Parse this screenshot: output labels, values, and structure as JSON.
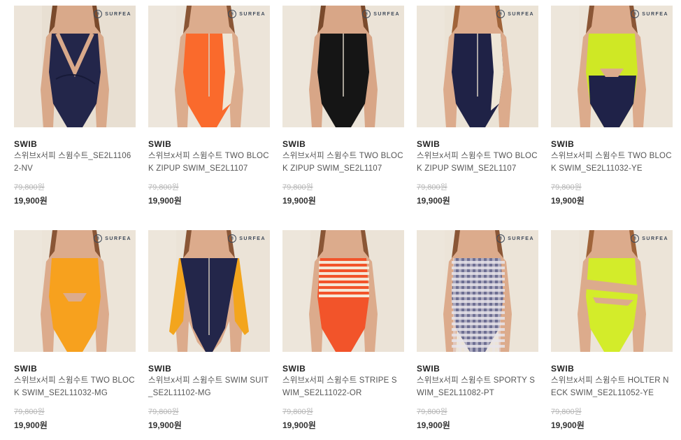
{
  "products": [
    {
      "brand": "SWIB",
      "name": "스위브x서피 스윔수트_SE2L11062-NV",
      "original_price": "79,800원",
      "sale_price": "19,900원",
      "logo_text": "SURFEA",
      "colors": {
        "bg": "#e8dfd2",
        "skin": "#d9a98a",
        "suit": "#23264a",
        "accent": "#23264a",
        "hair": "#7a4a2c"
      }
    },
    {
      "brand": "SWIB",
      "name": "스위브x서피 스윔수트 TWO BLOCK ZIPUP SWIM_SE2L1107",
      "original_price": "79,800원",
      "sale_price": "19,900원",
      "logo_text": "SURFEA",
      "colors": {
        "bg": "#ece4d9",
        "skin": "#dcac8d",
        "suit": "#fa6a2c",
        "accent": "#efe6d6",
        "hair": "#8a5636"
      }
    },
    {
      "brand": "SWIB",
      "name": "스위브x서피 스윔수트 TWO BLOCK ZIPUP SWIM_SE2L1107",
      "original_price": "79,800원",
      "sale_price": "19,900원",
      "logo_text": "SURFEA",
      "colors": {
        "bg": "#ebe3d7",
        "skin": "#d8a687",
        "suit": "#151515",
        "accent": "#151515",
        "hair": "#7a4a2c"
      }
    },
    {
      "brand": "SWIB",
      "name": "스위브x서피 스윔수트 TWO BLOCK ZIPUP SWIM_SE2L1107",
      "original_price": "79,800원",
      "sale_price": "19,900원",
      "logo_text": "SURFEA",
      "colors": {
        "bg": "#ebe3d6",
        "skin": "#dcab8c",
        "suit": "#1f2246",
        "accent": "#eee6d6",
        "hair": "#a0643a"
      }
    },
    {
      "brand": "SWIB",
      "name": "스위브x서피 스윔수트 TWO BLOCK SWIM_SE2L11032-YE",
      "original_price": "79,800원",
      "sale_price": "19,900원",
      "logo_text": "SURFEA",
      "colors": {
        "bg": "#ece4d8",
        "skin": "#dcab8c",
        "suit": "#cfe825",
        "accent": "#1f2248",
        "hair": "#8a5636"
      }
    },
    {
      "brand": "SWIB",
      "name": "스위브x서피 스윔수트 TWO BLOCK SWIM_SE2L11032-MG",
      "original_price": "79,800원",
      "sale_price": "19,900원",
      "logo_text": "SURFEA",
      "colors": {
        "bg": "#ece4d8",
        "skin": "#dcab8c",
        "suit": "#f7a11e",
        "accent": "#f7a11e",
        "hair": "#8a5636"
      }
    },
    {
      "brand": "SWIB",
      "name": "스위브x서피 스윔수트 SWIM SUIT_SE2L11102-MG",
      "original_price": "79,800원",
      "sale_price": "19,900원",
      "logo_text": "SURFEA",
      "colors": {
        "bg": "#ebe3d7",
        "skin": "#dcab8c",
        "suit": "#23264a",
        "accent": "#f3a51d",
        "hair": "#8a5636"
      }
    },
    {
      "brand": "SWIB",
      "name": "스위브x서피 스윔수트 STRIPE SWIM_SE2L11022-OR",
      "original_price": "79,800원",
      "sale_price": "19,900원",
      "logo_text": "",
      "colors": {
        "bg": "#ebe3d7",
        "skin": "#dcab8c",
        "suit": "#f2542a",
        "accent": "#f5e7d6",
        "hair": "#8a5636"
      }
    },
    {
      "brand": "SWIB",
      "name": "스위브x서피 스윔수트 SPORTY SWIM_SE2L11082-PT",
      "original_price": "79,800원",
      "sale_price": "19,900원",
      "logo_text": "SURFEA",
      "colors": {
        "bg": "#ece4d8",
        "skin": "#dcab8c",
        "suit": "#6e6f93",
        "accent": "#e8e4ea",
        "hair": "#8a5636"
      }
    },
    {
      "brand": "SWIB",
      "name": "스위브x서피 스윔수트 HOLTER NECK SWIM_SE2L11052-YE",
      "original_price": "79,800원",
      "sale_price": "19,900원",
      "logo_text": "SURFEA",
      "colors": {
        "bg": "#ece4d8",
        "skin": "#dcab8c",
        "suit": "#d3ec2a",
        "accent": "#d3ec2a",
        "hair": "#a0643a"
      }
    }
  ]
}
